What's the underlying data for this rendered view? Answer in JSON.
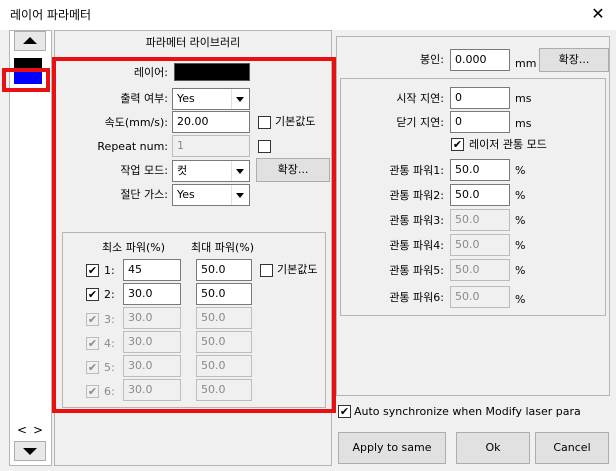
{
  "window": {
    "title": "레이어 파라메터",
    "close": "✕"
  },
  "colors": {
    "layer_black": "#000000",
    "layer_blue": "#0000ff",
    "highlight": "#e81010"
  },
  "left": {
    "nav_left": "<",
    "nav_right": ">"
  },
  "library": {
    "header": "파라메터 라이브러리"
  },
  "form": {
    "layer_label": "레이어:",
    "output_label": "출력 여부:",
    "output_value": "Yes",
    "speed_label": "속도(mm/s):",
    "speed_value": "20.00",
    "default_label": "기본값도",
    "repeat_label": "Repeat num:",
    "repeat_value": "1",
    "mode_label": "작업 모드:",
    "mode_value": "컷",
    "expand_label": "확장...",
    "gas_label": "절단 가스:",
    "gas_value": "Yes"
  },
  "power": {
    "min_header": "최소 파워(%)",
    "max_header": "최대 파워(%)",
    "default_label": "기본값도",
    "rows": [
      {
        "label": "1:",
        "min": "45",
        "max": "50.0",
        "checked": "✔"
      },
      {
        "label": "2:",
        "min": "30.0",
        "max": "50.0",
        "checked": "✔"
      },
      {
        "label": "3:",
        "min": "30.0",
        "max": "50.0",
        "checked": "✔"
      },
      {
        "label": "4:",
        "min": "30.0",
        "max": "50.0",
        "checked": "✔"
      },
      {
        "label": "5:",
        "min": "30.0",
        "max": "50.0",
        "checked": "✔"
      },
      {
        "label": "6:",
        "min": "30.0",
        "max": "50.0",
        "checked": "✔"
      }
    ]
  },
  "right": {
    "seal_label": "봉인:",
    "seal_value": "0.000",
    "seal_unit": "mm",
    "expand_label": "확장...",
    "start_delay_label": "시작 지연:",
    "start_delay_value": "0",
    "start_delay_unit": "ms",
    "close_delay_label": "닫기 지연:",
    "close_delay_value": "0",
    "close_delay_unit": "ms",
    "laser_mode_label": "레이저 관통 모드",
    "laser_mode_checked": "✔",
    "pierce": [
      {
        "label": "관통 파워1:",
        "value": "50.0",
        "unit": "%"
      },
      {
        "label": "관통 파워2:",
        "value": "50.0",
        "unit": "%"
      },
      {
        "label": "관통 파워3:",
        "value": "50.0",
        "unit": "%"
      },
      {
        "label": "관통 파워4:",
        "value": "50.0",
        "unit": "%"
      },
      {
        "label": "관통 파워5:",
        "value": "50.0",
        "unit": "%"
      },
      {
        "label": "관통 파워6:",
        "value": "50.0",
        "unit": "%"
      }
    ]
  },
  "footer": {
    "auto_sync_label": "Auto synchronize when Modify laser para",
    "auto_sync_checked": "✔",
    "apply_label": "Apply to same",
    "ok_label": "Ok",
    "cancel_label": "Cancel"
  }
}
